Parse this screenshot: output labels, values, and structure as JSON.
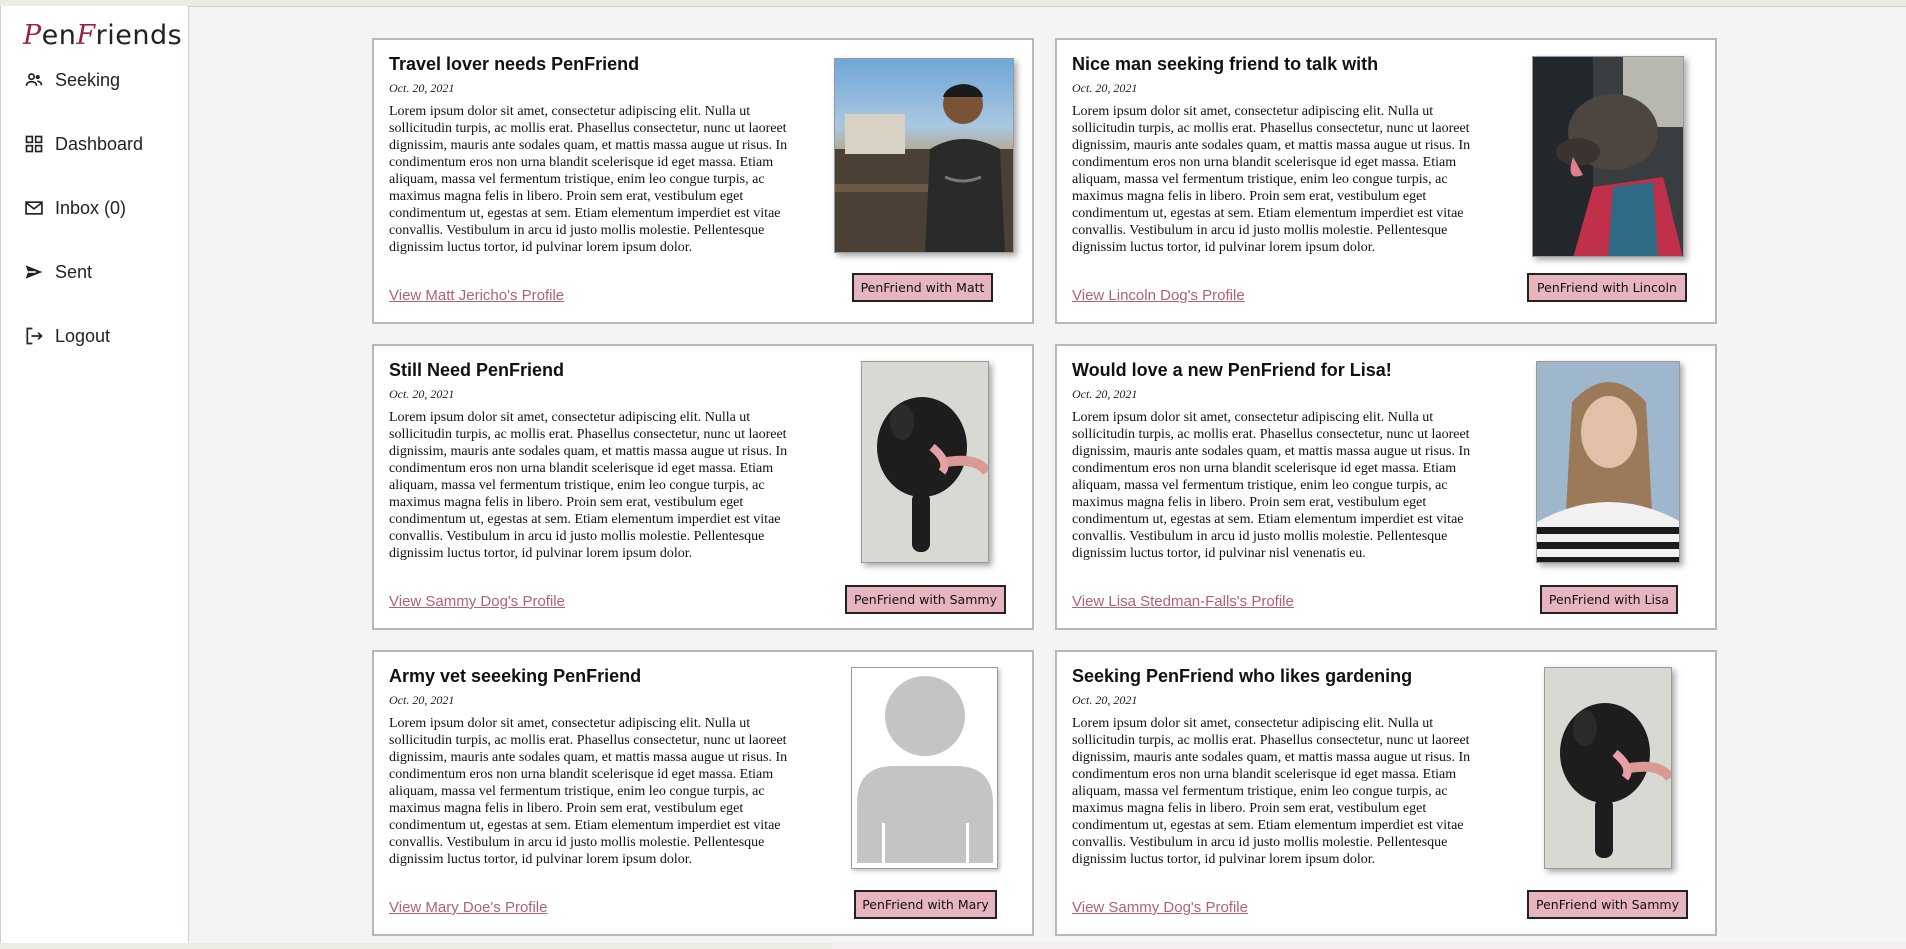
{
  "logo": {
    "p": "P",
    "en": "en",
    "f": "F",
    "riends": "riends"
  },
  "nav": [
    {
      "label": "Seeking",
      "icon": "people-icon"
    },
    {
      "label": "Dashboard",
      "icon": "dashboard-grid-icon"
    },
    {
      "label": "Inbox (0)",
      "icon": "mail-icon"
    },
    {
      "label": "Sent",
      "icon": "send-icon"
    },
    {
      "label": "Logout",
      "icon": "logout-icon"
    }
  ],
  "cards": [
    {
      "title": "Travel lover needs PenFriend",
      "date": "Oct. 20, 2021",
      "body": "Lorem ipsum dolor sit amet, consectetur adipiscing elit. Nulla ut sollicitudin turpis, ac mollis erat. Phasellus consectetur, nunc ut laoreet dignissim, mauris ante sodales quam, et mattis massa augue ut risus. In condimentum eros non urna blandit scelerisque id eget massa. Etiam aliquam, massa vel fermentum tristique, enim leo congue turpis, ac maximus magna felis in libero. Proin sem erat, vestibulum eget condimentum ut, egestas at sem. Etiam elementum imperdiet est vitae convallis. Vestibulum in arcu id justo mollis molestie. Pellentesque dignissim luctus tortor, id pulvinar lorem ipsum dolor.",
      "link": "View Matt Jericho's Profile",
      "button": "PenFriend with Matt",
      "photo": "man-photo"
    },
    {
      "title": "Nice man seeking friend to talk with",
      "date": "Oct. 20, 2021",
      "body": "Lorem ipsum dolor sit amet, consectetur adipiscing elit. Nulla ut sollicitudin turpis, ac mollis erat. Phasellus consectetur, nunc ut laoreet dignissim, mauris ante sodales quam, et mattis massa augue ut risus. In condimentum eros non urna blandit scelerisque id eget massa. Etiam aliquam, massa vel fermentum tristique, enim leo congue turpis, ac maximus magna felis in libero. Proin sem erat, vestibulum eget condimentum ut, egestas at sem. Etiam elementum imperdiet est vitae convallis. Vestibulum in arcu id justo mollis molestie. Pellentesque dignissim luctus tortor, id pulvinar lorem ipsum dolor.",
      "link": "View Lincoln Dog's Profile",
      "button": "PenFriend with Lincoln",
      "photo": "dog-photo"
    },
    {
      "title": "Still Need PenFriend",
      "date": "Oct. 20, 2021",
      "body": "Lorem ipsum dolor sit amet, consectetur adipiscing elit. Nulla ut sollicitudin turpis, ac mollis erat. Phasellus consectetur, nunc ut laoreet dignissim, mauris ante sodales quam, et mattis massa augue ut risus. In condimentum eros non urna blandit scelerisque id eget massa. Etiam aliquam, massa vel fermentum tristique, enim leo congue turpis, ac maximus magna felis in libero. Proin sem erat, vestibulum eget condimentum ut, egestas at sem. Etiam elementum imperdiet est vitae convallis. Vestibulum in arcu id justo mollis molestie. Pellentesque dignissim luctus tortor, id pulvinar lorem ipsum dolor.",
      "link": "View Sammy Dog's Profile",
      "button": "PenFriend with Sammy",
      "photo": "dog-photo"
    },
    {
      "title": "Would love a new PenFriend for Lisa!",
      "date": "Oct. 20, 2021",
      "body": "Lorem ipsum dolor sit amet, consectetur adipiscing elit. Nulla ut sollicitudin turpis, ac mollis erat. Phasellus consectetur, nunc ut laoreet dignissim, mauris ante sodales quam, et mattis massa augue ut risus. In condimentum eros non urna blandit scelerisque id eget massa. Etiam aliquam, massa vel fermentum tristique, enim leo congue turpis, ac maximus magna felis in libero. Proin sem erat, vestibulum eget condimentum ut, egestas at sem. Etiam elementum imperdiet est vitae convallis. Vestibulum in arcu id justo mollis molestie. Pellentesque dignissim luctus tortor, id pulvinar nisl venenatis eu.",
      "link": "View Lisa Stedman-Falls's Profile",
      "button": "PenFriend with Lisa",
      "photo": "woman-photo"
    },
    {
      "title": "Army vet seeeking PenFriend",
      "date": "Oct. 20, 2021",
      "body": "Lorem ipsum dolor sit amet, consectetur adipiscing elit. Nulla ut sollicitudin turpis, ac mollis erat. Phasellus consectetur, nunc ut laoreet dignissim, mauris ante sodales quam, et mattis massa augue ut risus. In condimentum eros non urna blandit scelerisque id eget massa. Etiam aliquam, massa vel fermentum tristique, enim leo congue turpis, ac maximus magna felis in libero. Proin sem erat, vestibulum eget condimentum ut, egestas at sem. Etiam elementum imperdiet est vitae convallis. Vestibulum in arcu id justo mollis molestie. Pellentesque dignissim luctus tortor, id pulvinar lorem ipsum dolor.",
      "link": "View Mary Doe's Profile",
      "button": "PenFriend with Mary",
      "photo": "avatar-placeholder"
    },
    {
      "title": "Seeking PenFriend who likes gardening",
      "date": "Oct. 20, 2021",
      "body": "Lorem ipsum dolor sit amet, consectetur adipiscing elit. Nulla ut sollicitudin turpis, ac mollis erat. Phasellus consectetur, nunc ut laoreet dignissim, mauris ante sodales quam, et mattis massa augue ut risus. In condimentum eros non urna blandit scelerisque id eget massa. Etiam aliquam, massa vel fermentum tristique, enim leo congue turpis, ac maximus magna felis in libero. Proin sem erat, vestibulum eget condimentum ut, egestas at sem. Etiam elementum imperdiet est vitae convallis. Vestibulum in arcu id justo mollis molestie. Pellentesque dignissim luctus tortor, id pulvinar lorem ipsum dolor.",
      "link": "View Sammy Dog's Profile",
      "button": "PenFriend with Sammy",
      "photo": "dog-photo"
    }
  ],
  "colors": {
    "accent": "#9c1e4a",
    "link": "#b0617a",
    "button_bg": "#e7b5c0"
  }
}
